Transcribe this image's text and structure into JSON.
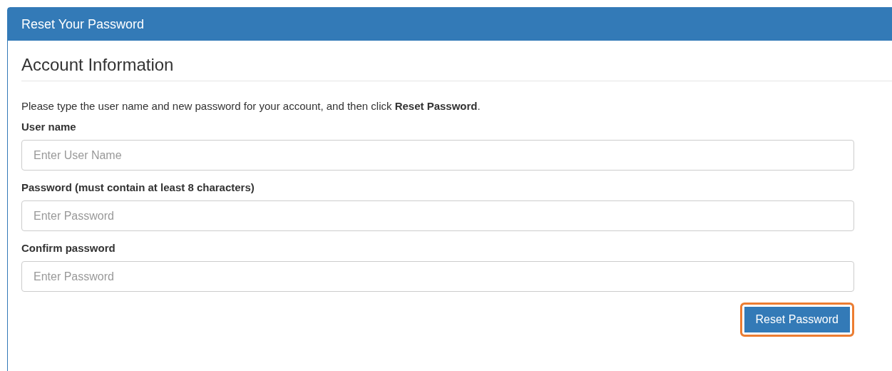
{
  "panel": {
    "title": "Reset Your Password"
  },
  "section": {
    "heading": "Account Information",
    "intro": "Please type the user name and new password for your account, and then click **Reset Password**."
  },
  "fields": [
    {
      "label": "User name",
      "placeholder": "Enter User Name"
    },
    {
      "label": "Password (must contain at least 8 characters)",
      "placeholder": "Enter Password"
    },
    {
      "label": "Confirm password",
      "placeholder": "Enter Password"
    }
  ],
  "submit": {
    "label": "Reset Password",
    "highlighted": true
  }
}
